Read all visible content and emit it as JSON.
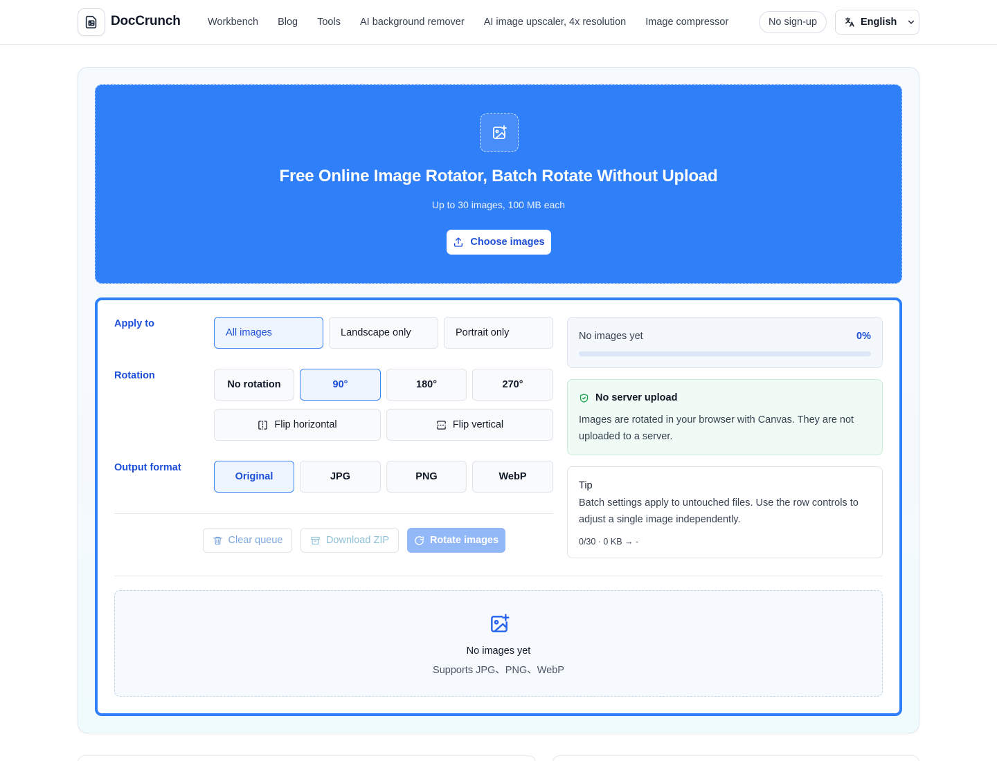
{
  "header": {
    "brand": "DocCrunch",
    "nav": [
      "Workbench",
      "Blog",
      "Tools",
      "AI background remover",
      "AI image upscaler, 4x resolution",
      "Image compressor"
    ],
    "pill": "No sign-up",
    "language": "English"
  },
  "hero": {
    "title": "Free Online Image Rotator, Batch Rotate Without Upload",
    "subtitle": "Up to 30 images, 100 MB each",
    "choose_label": "Choose images"
  },
  "settings": {
    "apply_label": "Apply to",
    "apply_options": [
      "All images",
      "Landscape only",
      "Portrait only"
    ],
    "apply_selected": "All images",
    "rotation_label": "Rotation",
    "rotation_options": [
      "No rotation",
      "90°",
      "180°",
      "270°"
    ],
    "rotation_selected": "90°",
    "flip_options": [
      "Flip horizontal",
      "Flip vertical"
    ],
    "format_label": "Output format",
    "format_options": [
      "Original",
      "JPG",
      "PNG",
      "WebP"
    ],
    "format_selected": "Original"
  },
  "actions": {
    "clear": "Clear queue",
    "download": "Download ZIP",
    "rotate": "Rotate images"
  },
  "progress": {
    "label": "No images yet",
    "percent_text": "0%",
    "fraction": 0
  },
  "privacy_note": {
    "title": "No server upload",
    "body": "Images are rotated in your browser with Canvas. They are not uploaded to a server."
  },
  "tip": {
    "title": "Tip",
    "body": "Batch settings apply to untouched files. Use the row controls to adjust a single image independently.",
    "meta": "0/30 · 0 KB → -"
  },
  "queue": {
    "empty_title": "No images yet",
    "empty_sub": "Supports JPG、PNG、WebP"
  },
  "colors": {
    "accent": "#2f7ff8",
    "accent_text": "#1d4ed8",
    "success_bg": "#effbf4"
  },
  "icons": {
    "logo": "document-image-icon",
    "language": "translate-icon",
    "hero": "image-plus-icon",
    "upload": "upload-icon",
    "flip_h": "flip-horizontal-icon",
    "flip_v": "flip-vertical-icon",
    "clear": "trash-icon",
    "zip": "archive-icon",
    "rotate": "rotate-cw-icon",
    "shield": "shield-check-icon"
  }
}
